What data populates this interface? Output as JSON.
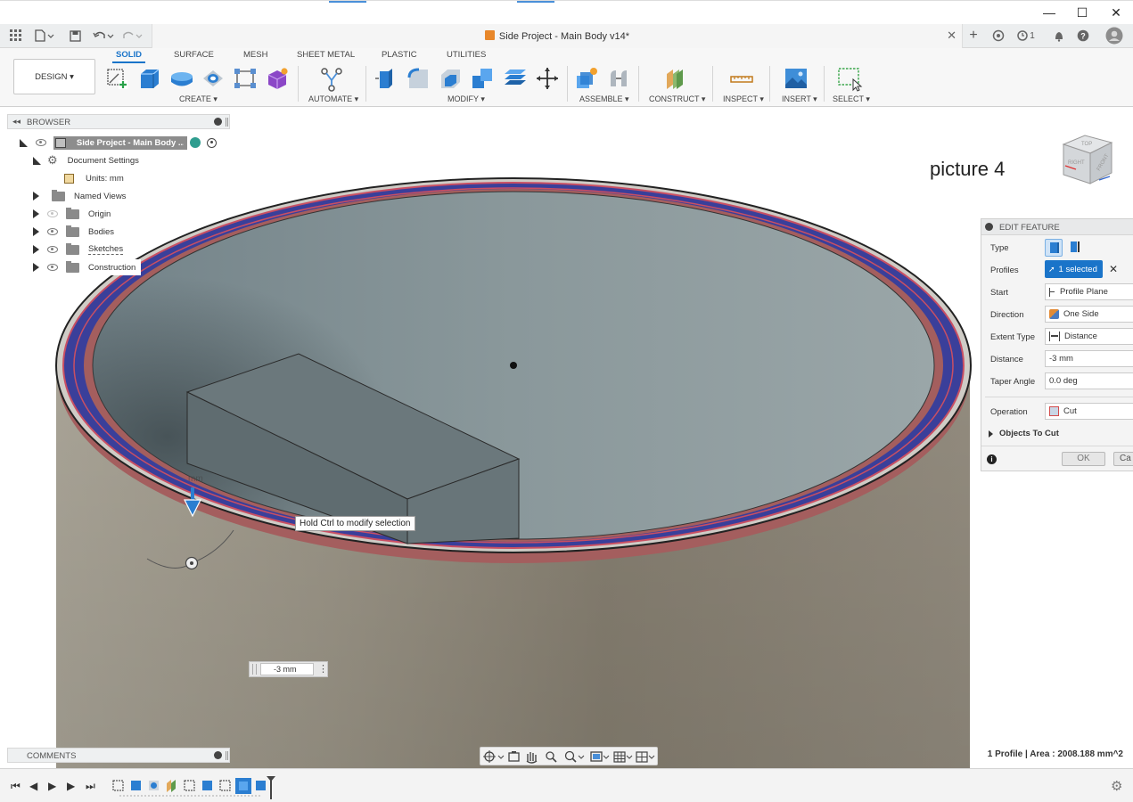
{
  "window": {
    "title": "Side Project - Main Body v14*",
    "buttons": [
      "minimize",
      "maximize",
      "close"
    ]
  },
  "tabbar": {
    "notification_count": "1"
  },
  "ribbon": {
    "workspace_button": "DESIGN ▾",
    "tabs": [
      "SOLID",
      "SURFACE",
      "MESH",
      "SHEET METAL",
      "PLASTIC",
      "UTILITIES"
    ],
    "active_tab": "SOLID",
    "groups": {
      "create": "CREATE ▾",
      "automate": "AUTOMATE ▾",
      "modify": "MODIFY ▾",
      "assemble": "ASSEMBLE ▾",
      "construct": "CONSTRUCT ▾",
      "inspect": "INSPECT ▾",
      "insert": "INSERT ▾",
      "select": "SELECT ▾"
    }
  },
  "browser": {
    "title": "BROWSER",
    "root": "Side Project - Main Body ...",
    "items": [
      {
        "label": "Document Settings"
      },
      {
        "label": "Units: mm"
      },
      {
        "label": "Named Views"
      },
      {
        "label": "Origin"
      },
      {
        "label": "Bodies"
      },
      {
        "label": "Sketches"
      },
      {
        "label": "Construction"
      }
    ]
  },
  "viewport": {
    "annotation": "picture 4",
    "tooltip": "Hold Ctrl to modify selection",
    "distance_input": "-3 mm",
    "viewcube_labels": [
      "TOP",
      "FRONT",
      "RIGHT"
    ]
  },
  "edit_feature": {
    "title": "EDIT FEATURE",
    "rows": {
      "type": "Type",
      "profiles": "Profiles",
      "profiles_value": "1 selected",
      "start": "Start",
      "start_value": "Profile Plane",
      "direction": "Direction",
      "direction_value": "One Side",
      "extent_type": "Extent Type",
      "extent_type_value": "Distance",
      "distance": "Distance",
      "distance_value": "-3 mm",
      "taper_angle": "Taper Angle",
      "taper_angle_value": "0.0 deg",
      "operation": "Operation",
      "operation_value": "Cut",
      "objects_to_cut": "Objects To Cut"
    },
    "ok": "OK",
    "cancel": "Ca"
  },
  "comments": {
    "title": "COMMENTS"
  },
  "status": {
    "text": "1 Profile | Area : 2008.188 mm^2"
  },
  "colors": {
    "accent": "#1a74c9",
    "profile_blue": "#3a3f9a",
    "profile_red": "#b54a52",
    "body_outer": "#9e988a",
    "body_inner": "#7f8d91"
  }
}
